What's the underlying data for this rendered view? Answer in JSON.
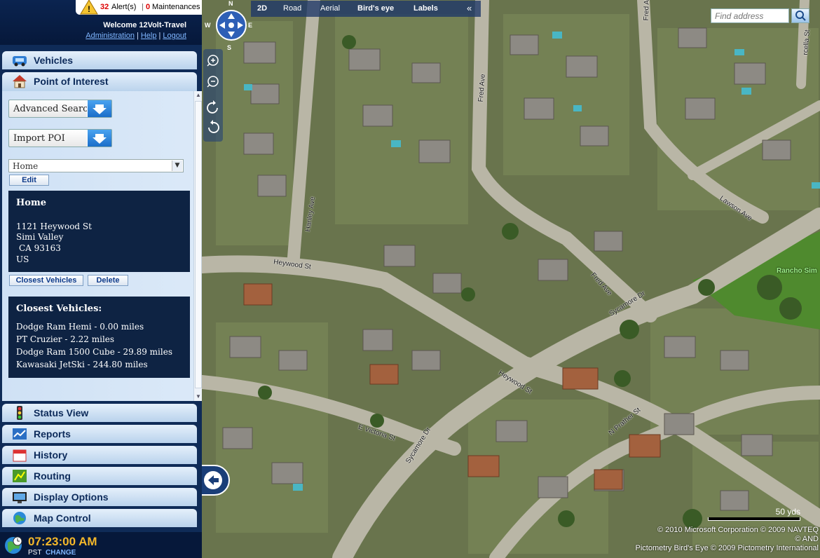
{
  "header": {
    "alert_count": "32",
    "alert_label": "Alert(s)",
    "alert_separator": "|",
    "maintenance_count": "0",
    "maintenance_label": "Maintenances",
    "welcome": "Welcome 12Volt-Travel",
    "links": {
      "administration": "Administration",
      "help": "Help",
      "logout": "Logout"
    },
    "link_separator": "|"
  },
  "nav": {
    "vehicles": "Vehicles",
    "poi": "Point of Interest",
    "status_view": "Status View",
    "reports": "Reports",
    "history": "History",
    "routing": "Routing",
    "display_options": "Display Options",
    "map_control": "Map Control"
  },
  "poi": {
    "advanced_search": "Advanced Search",
    "import_poi": "Import POI",
    "selected": "Home",
    "edit_label": "Edit",
    "detail": {
      "name": "Home",
      "street": "1121 Heywood St",
      "city": "Simi Valley",
      "state_zip": "CA 93163",
      "country": "US"
    },
    "closest_vehicles_button": "Closest Vehicles",
    "delete_button": "Delete",
    "closest": {
      "title": "Closest Vehicles:",
      "items": [
        "Dodge Ram Hemi - 0.00 miles",
        "PT Cruzier - 2.22 miles",
        "Dodge Ram 1500 Cube - 29.89 miles",
        "Kawasaki JetSki - 244.80 miles"
      ]
    }
  },
  "clock": {
    "time": "07:23:00 AM",
    "timezone": "PST",
    "change": "CHANGE"
  },
  "map": {
    "compass": {
      "n": "N",
      "s": "S",
      "e": "E",
      "w": "W"
    },
    "toolbar": {
      "mode_2d": "2D",
      "road": "Road",
      "aerial": "Aerial",
      "birds_eye": "Bird's eye",
      "labels": "Labels",
      "collapse": "«"
    },
    "search_placeholder": "Find address",
    "streets": {
      "heywood_top": "Heywood St",
      "heywood_mid": "Heywood St",
      "hanley": "Hanley Ave",
      "fred_top": "Fred Ave",
      "fred_mid": "Fred Ave",
      "sycamore_mid": "Sycamore Dr",
      "sycamore_bottom": "Sycamore Dr",
      "lawson": "Lawson Ave",
      "e_victoria": "E Victoria St",
      "n_prather": "N Prather St",
      "rancho": "Rancho Sim",
      "fred_corner": "Fred Ave",
      "arcella": "rcella St"
    },
    "scale": "50 yds",
    "credits": [
      "© 2010 Microsoft Corporation   © 2009 NAVTEQ",
      "© AND",
      "Pictometry Bird's Eye © 2009 Pictometry International"
    ]
  },
  "colors": {
    "accent": "#0e2343",
    "alert": "#dd0000",
    "link": "#7fb6ff",
    "clock": "#f5b82a"
  }
}
